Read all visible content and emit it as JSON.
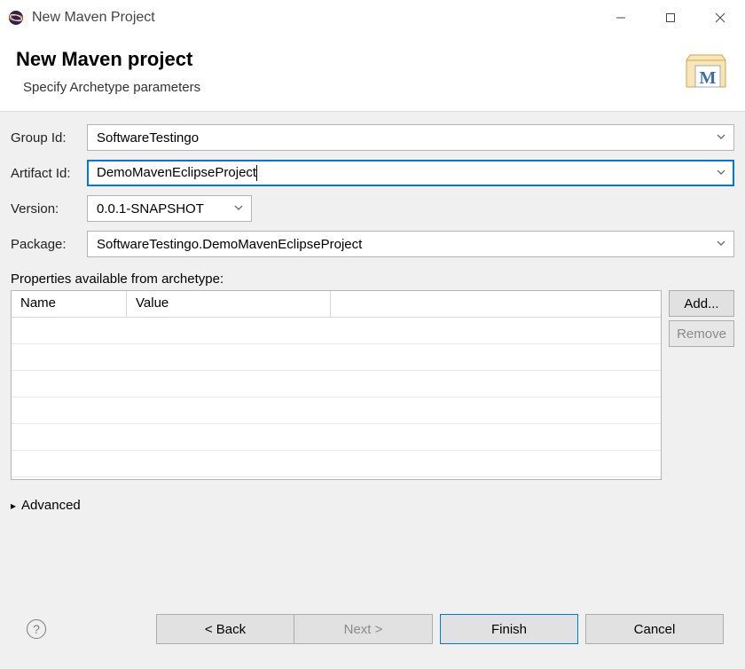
{
  "window": {
    "title": "New Maven Project"
  },
  "header": {
    "title": "New Maven project",
    "subtitle": "Specify Archetype parameters"
  },
  "form": {
    "group_id_label": "Group Id:",
    "group_id_value": "SoftwareTestingo",
    "artifact_id_label": "Artifact Id:",
    "artifact_id_value": "DemoMavenEclipseProject",
    "version_label": "Version:",
    "version_value": "0.0.1-SNAPSHOT",
    "package_label": "Package:",
    "package_value": "SoftwareTestingo.DemoMavenEclipseProject"
  },
  "properties": {
    "label": "Properties available from archetype:",
    "columns": {
      "name": "Name",
      "value": "Value"
    },
    "rows": []
  },
  "side_buttons": {
    "add": "Add...",
    "remove": "Remove"
  },
  "advanced_label": "Advanced",
  "buttons": {
    "back": "< Back",
    "next": "Next >",
    "finish": "Finish",
    "cancel": "Cancel"
  }
}
